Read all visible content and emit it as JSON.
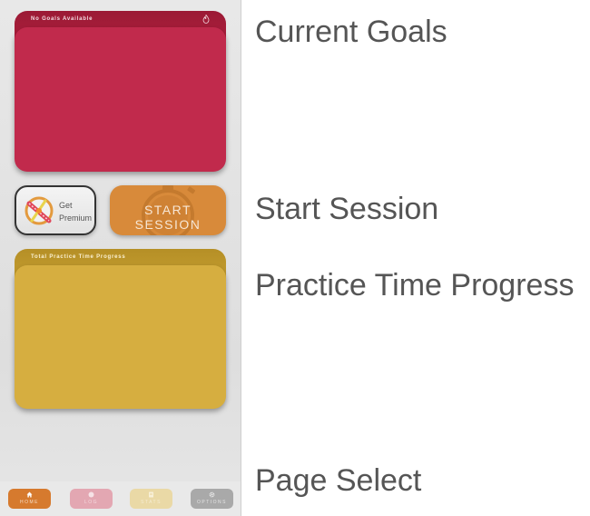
{
  "goals_card": {
    "title": "No Goals Available",
    "icon": "flame-icon",
    "color": "#c12a4c"
  },
  "premium": {
    "line1": "Get",
    "line2": "Premium",
    "icon": "rewards-badge-icon"
  },
  "start_session": {
    "label": "START SESSION",
    "color": "#d88a3a"
  },
  "practice_card": {
    "title": "Total Practice Time Progress",
    "color": "#d6ae40"
  },
  "nav": {
    "home": {
      "label": "HOME",
      "icon": "home-icon"
    },
    "log": {
      "label": "LOG",
      "icon": "log-icon"
    },
    "stats": {
      "label": "STATS",
      "icon": "stats-icon"
    },
    "options": {
      "label": "OPTIONS",
      "icon": "gear-icon"
    }
  },
  "annotations": {
    "current_goals": "Current Goals",
    "start_session": "Start Session",
    "practice_time_progress": "Practice Time Progress",
    "page_select": "Page Select"
  }
}
